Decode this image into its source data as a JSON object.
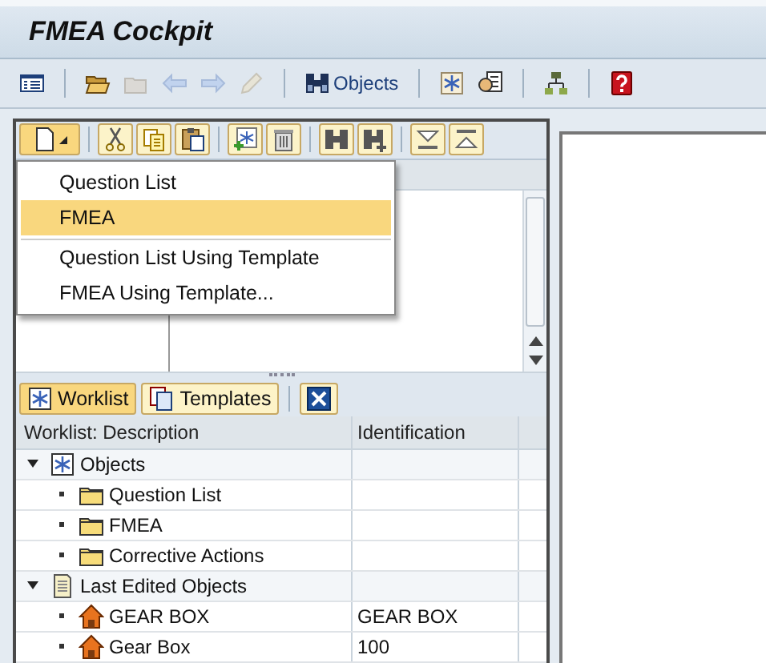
{
  "window": {
    "title": "FMEA Cockpit"
  },
  "toolbar": [
    {
      "disabled": false
    },
    {
      "disabled": false
    },
    {
      "disabled": true
    },
    {
      "disabled": true
    },
    {
      "disabled": true
    },
    {
      "disabled": true
    },
    {
      "label": "Objects",
      "disabled": false
    },
    {
      "disabled": false
    },
    {
      "disabled": false
    },
    {
      "disabled": false
    },
    {
      "disabled": false
    }
  ],
  "create_menu": {
    "open": true,
    "items": [
      {
        "label": "Question List",
        "selected": false,
        "separator_before": false
      },
      {
        "label": "FMEA",
        "selected": true,
        "separator_before": false
      },
      {
        "label": "Question List Using Template",
        "selected": false,
        "separator_before": true
      },
      {
        "label": "FMEA Using Template...",
        "selected": false,
        "separator_before": false
      }
    ]
  },
  "tabs": [
    {
      "label": "Worklist",
      "selected": true
    },
    {
      "label": "Templates",
      "selected": false
    }
  ],
  "worklist": {
    "columns": [
      "Worklist: Description",
      "Identification"
    ],
    "tree": [
      {
        "label": "Objects",
        "expanded": true,
        "children": [
          {
            "label": "Question List",
            "kind": "folder"
          },
          {
            "label": "FMEA",
            "kind": "folder"
          },
          {
            "label": "Corrective Actions",
            "kind": "folder"
          }
        ]
      },
      {
        "label": "Last Edited Objects",
        "expanded": true,
        "children": [
          {
            "label": "GEAR BOX",
            "kind": "object",
            "identification": "GEAR BOX"
          },
          {
            "label": "Gear Box",
            "kind": "object",
            "identification": "100"
          }
        ]
      }
    ]
  }
}
